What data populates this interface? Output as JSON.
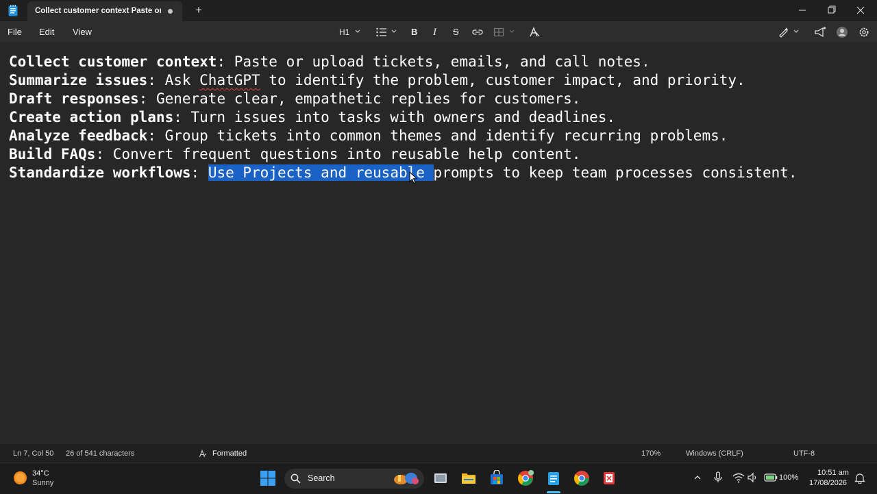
{
  "window": {
    "tab_title": "Collect customer context Paste or u",
    "new_tab_label": "+"
  },
  "menu": {
    "file": "File",
    "edit": "Edit",
    "view": "View"
  },
  "toolbar": {
    "heading_label": "H1",
    "bold_label": "B",
    "italic_label": "I",
    "strike_label": "S"
  },
  "document": {
    "lines": [
      {
        "bold": "Collect customer context",
        "rest": ": Paste or upload tickets, emails, and call notes."
      },
      {
        "bold": "Summarize issues",
        "rest_before": ": Ask ",
        "flagged_word": "ChatGPT",
        "rest": " to identify the problem, customer impact, and priority."
      },
      {
        "bold": "Draft responses",
        "rest": ": Generate clear, empathetic replies for customers."
      },
      {
        "bold": "Create action plans",
        "rest": ": Turn issues into tasks with owners and deadlines."
      },
      {
        "bold": "Analyze feedback",
        "rest": ": Group tickets into common themes and identify recurring problems."
      },
      {
        "bold": "Build FAQs",
        "rest": ": Convert frequent questions into reusable help content."
      },
      {
        "bold": "Standardize workflows",
        "rest_before": ": ",
        "selected": "Use Projects and reusable ",
        "rest": "prompts to keep team processes consistent."
      }
    ]
  },
  "status": {
    "position": "Ln 7, Col 50",
    "selection": "26 of 541 characters",
    "mode": "Formatted",
    "zoom": "170%",
    "line_ending": "Windows (CRLF)",
    "encoding": "UTF-8"
  },
  "taskbar": {
    "weather_temp": "34°C",
    "weather_desc": "Sunny",
    "search_label": "Search",
    "battery": "100%",
    "time": "10:51 am",
    "date": "17/08/2026"
  },
  "colors": {
    "selection": "#1a62c6",
    "background": "#272727",
    "spell_error": "#e0403a"
  }
}
